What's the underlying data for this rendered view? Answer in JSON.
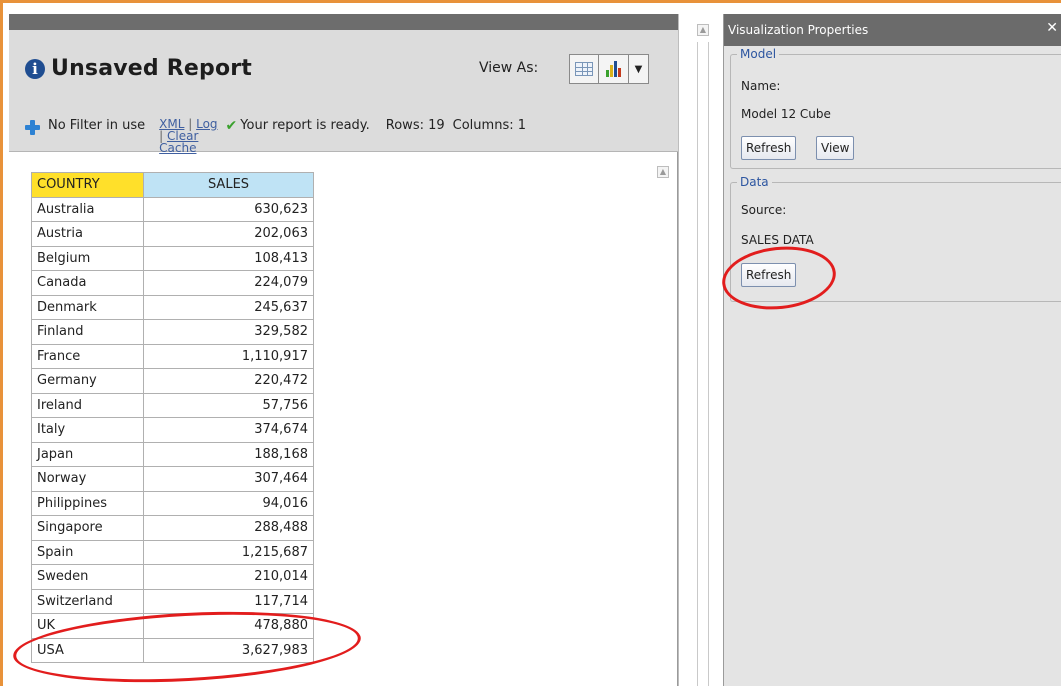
{
  "report": {
    "title": "Unsaved Report",
    "view_as_label": "View As:",
    "filter_text": "No Filter in use",
    "links": {
      "xml": "XML",
      "sep1": "|",
      "log": "Log",
      "sep2": "|",
      "clear": "Clear",
      "cache": "Cache"
    },
    "status": "Your report is ready.",
    "rows_label": "Rows: 19",
    "columns_label": "Columns: 1",
    "table": {
      "headers": [
        "COUNTRY",
        "SALES"
      ],
      "rows": [
        [
          "Australia",
          "630,623"
        ],
        [
          "Austria",
          "202,063"
        ],
        [
          "Belgium",
          "108,413"
        ],
        [
          "Canada",
          "224,079"
        ],
        [
          "Denmark",
          "245,637"
        ],
        [
          "Finland",
          "329,582"
        ],
        [
          "France",
          "1,110,917"
        ],
        [
          "Germany",
          "220,472"
        ],
        [
          "Ireland",
          "57,756"
        ],
        [
          "Italy",
          "374,674"
        ],
        [
          "Japan",
          "188,168"
        ],
        [
          "Norway",
          "307,464"
        ],
        [
          "Philippines",
          "94,016"
        ],
        [
          "Singapore",
          "288,488"
        ],
        [
          "Spain",
          "1,215,687"
        ],
        [
          "Sweden",
          "210,014"
        ],
        [
          "Switzerland",
          "117,714"
        ],
        [
          "UK",
          "478,880"
        ],
        [
          "USA",
          "3,627,983"
        ]
      ]
    }
  },
  "properties": {
    "title": "Visualization Properties",
    "close": "✕",
    "model": {
      "legend": "Model",
      "name_label": "Name:",
      "name_value": "Model 12 Cube",
      "refresh_label": "Refresh",
      "view_label": "View"
    },
    "data": {
      "legend": "Data",
      "source_label": "Source:",
      "source_value": "SALES DATA",
      "refresh_label": "Refresh"
    }
  },
  "colors": {
    "frame_orange": "#e8923a",
    "header_country": "#ffe02a",
    "header_sales": "#bfe3f5",
    "annotation_red": "#e21d1d",
    "link_blue": "#3f5fa0"
  }
}
